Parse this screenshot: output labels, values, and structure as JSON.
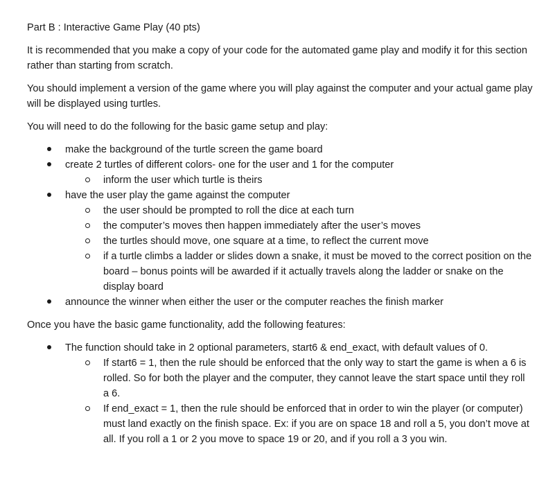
{
  "heading": "Part B : Interactive Game Play (40 pts)",
  "paragraphs": [
    "It is recommended that you make a copy of your code for the automated game play and modify it for this section rather than starting from scratch.",
    "You should implement a version of the game where you will play against the computer and your actual game play will be displayed using turtles.",
    "You will need to do the following for the basic game setup and play:"
  ],
  "basic_list": [
    "make the background of the turtle screen the game board",
    "create 2 turtles of different colors- one for the user and 1 for the computer",
    "inform the user which turtle is theirs",
    "have the user play the game against the computer",
    "the user should be prompted to roll the dice at each turn",
    "the computer’s moves then happen immediately after the user’s moves",
    "the turtles should move, one square at a time, to reflect the current move",
    "if a turtle climbs a ladder or slides down a snake, it must be moved to the correct position on the board – bonus points will be awarded if it actually travels along the ladder or snake on the display board",
    "announce the winner when either the user or the computer reaches the finish marker"
  ],
  "features_intro": "Once you have the basic game functionality, add the following features:",
  "features_list": [
    "The function should take in 2 optional parameters, start6 & end_exact, with default values of 0.",
    "If start6 = 1, then the rule should be enforced that the only way to start the game is when a 6 is rolled.  So for both the player and the computer, they cannot leave the start space until they roll a 6.",
    "If end_exact = 1, then the rule should be enforced that in order to win the player (or computer) must land exactly on the finish space.  Ex: if you are on space 18 and roll a 5, you don’t move at all.  If you roll a 1 or 2 you move to space 19 or 20, and if you roll a 3 you win."
  ]
}
